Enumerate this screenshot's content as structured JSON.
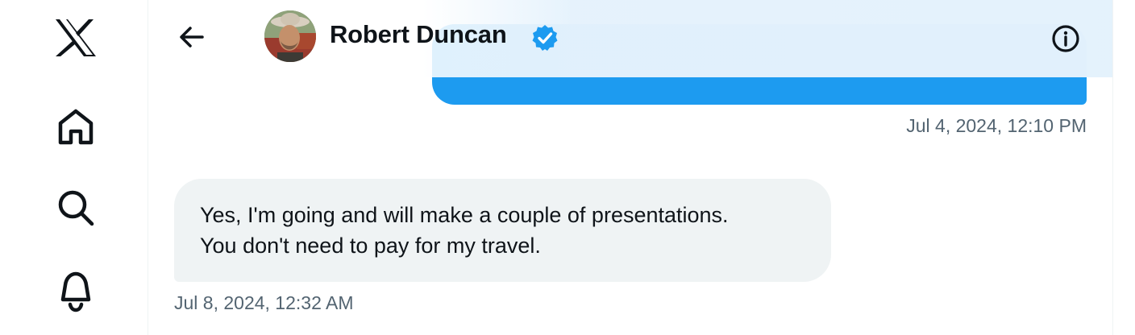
{
  "nav": {
    "items": [
      {
        "icon": "x-logo-icon"
      },
      {
        "icon": "home-icon"
      },
      {
        "icon": "search-icon"
      },
      {
        "icon": "notifications-bell-icon"
      }
    ]
  },
  "header": {
    "contact_name": "Robert Duncan",
    "verified": true,
    "accent_color": "#1d9bf0"
  },
  "messages": [
    {
      "direction": "outgoing",
      "text_visible": false,
      "timestamp": "Jul 4, 2024, 12:10 PM",
      "bubble_color": "#1d9bf0"
    },
    {
      "direction": "incoming",
      "lines": [
        "Yes, I'm going and will make a couple of presentations.",
        "You don't need to pay for my travel."
      ],
      "timestamp": "Jul 8, 2024, 12:32 AM",
      "bubble_color": "#eff3f4"
    }
  ]
}
